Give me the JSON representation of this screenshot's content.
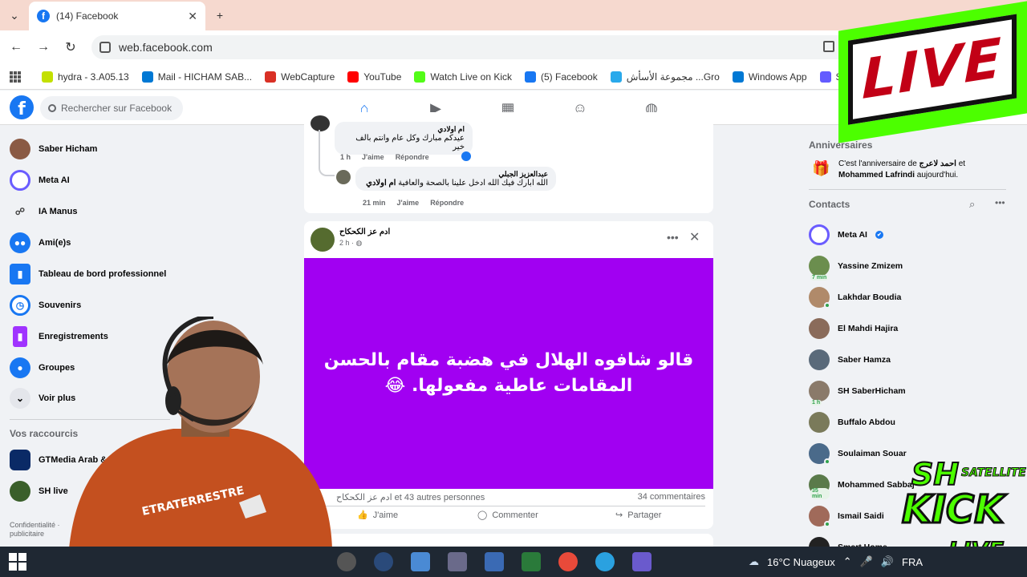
{
  "browser": {
    "tab_title": "(14) Facebook",
    "url": "web.facebook.com",
    "bookmarks": [
      {
        "label": "hydra - 3.A05.13",
        "color": "#c3e000"
      },
      {
        "label": "Mail - HICHAM SAB...",
        "color": "#0078d4"
      },
      {
        "label": "WebCapture",
        "color": "#d93025"
      },
      {
        "label": "YouTube",
        "color": "#ff0000"
      },
      {
        "label": "Watch Live on Kick",
        "color": "#53fc18"
      },
      {
        "label": "(5) Facebook",
        "color": "#1877f2"
      },
      {
        "label": "مجموعة الأسأش ...Gro",
        "color": "#29a9eb"
      },
      {
        "label": "Windows App",
        "color": "#0078d4"
      },
      {
        "label": "Stripe Express",
        "color": "#635bff"
      }
    ]
  },
  "facebook": {
    "search_placeholder": "Rechercher sur Facebook",
    "left_nav": [
      {
        "label": "Saber Hicham",
        "icon": "user-avatar",
        "color": "#8a5a44"
      },
      {
        "label": "Meta AI",
        "icon": "meta-ai-icon",
        "color": "#6a5cff"
      },
      {
        "label": "IA Manus",
        "icon": "manus-icon",
        "color": "#444444"
      },
      {
        "label": "Ami(e)s",
        "icon": "friends-icon",
        "color": "#1877f2"
      },
      {
        "label": "Tableau de bord professionnel",
        "icon": "dashboard-icon",
        "color": "#1877f2"
      },
      {
        "label": "Souvenirs",
        "icon": "memories-icon",
        "color": "#1877f2"
      },
      {
        "label": "Enregistrements",
        "icon": "saved-icon",
        "color": "#a033ff"
      },
      {
        "label": "Groupes",
        "icon": "groups-icon",
        "color": "#1877f2"
      },
      {
        "label": "Voir plus",
        "icon": "chevron-down-icon",
        "color": "#e4e6eb"
      }
    ],
    "shortcuts_title": "Vos raccourcis",
    "shortcuts": [
      {
        "label": "GTMedia Arab & Eu...",
        "color": "#0a2a66"
      },
      {
        "label": "SH live",
        "color": "#3a5f2a"
      }
    ],
    "privacy_text": "Confidentialité · publicitaire"
  },
  "feed": {
    "comment1": {
      "author": "ام اولادي",
      "text": "عيدكم مبارك وكل عام وانتم بالف خير",
      "time": "1 h",
      "like": "J'aime",
      "reply": "Répondre"
    },
    "comment2": {
      "author": "عبدالعزيز الجبلي",
      "mention": "ام اولادي",
      "text": "الله ابارك فيك الله ادخل علينا بالصحة والعافية",
      "time": "21 min",
      "like": "J'aime",
      "reply": "Répondre"
    },
    "post": {
      "author": "ادم عز الكحكاح",
      "time": "2 h",
      "line1": "قالو شافوه الهلال في هضبة مقام بالحسن",
      "line2": "المقامات عاطية مفعولها. 😂",
      "reactions": "ادم عز الكحكاح et 43 autres personnes",
      "comments": "34 commentaires",
      "like": "J'aime",
      "comment": "Commenter",
      "share": "Partager"
    }
  },
  "right_column": {
    "birthdays_title": "Anniversaires",
    "birthday_prefix": "C'est l'anniversaire de ",
    "birthday_name1": "احمد لاعرج",
    "birthday_and": " et ",
    "birthday_name2": "Mohammed Lafrindi",
    "birthday_suffix": " aujourd'hui.",
    "contacts_title": "Contacts",
    "contacts": [
      {
        "name": "Meta AI",
        "color": "#6a5cff",
        "online": false,
        "ago": ""
      },
      {
        "name": "Yassine Zmizem",
        "color": "#6b8e4e",
        "online": false,
        "ago": "7 min"
      },
      {
        "name": "Lakhdar Boudia",
        "color": "#b08a6a",
        "online": true,
        "ago": ""
      },
      {
        "name": "El Mahdi Hajira",
        "color": "#8a6b5a",
        "online": false,
        "ago": ""
      },
      {
        "name": "Saber Hamza",
        "color": "#5a6a7a",
        "online": false,
        "ago": ""
      },
      {
        "name": "SH SaberHicham",
        "color": "#8a7a6a",
        "online": false,
        "ago": "1 h"
      },
      {
        "name": "Buffalo Abdou",
        "color": "#7a7a5a",
        "online": false,
        "ago": ""
      },
      {
        "name": "Soulaiman Souar",
        "color": "#4a6a8a",
        "online": true,
        "ago": ""
      },
      {
        "name": "Mohammed Sabbaj",
        "color": "#5a7a4a",
        "online": false,
        "ago": "35 min"
      },
      {
        "name": "Ismail Saidi",
        "color": "#a06a5a",
        "online": true,
        "ago": ""
      },
      {
        "name": "Smart Home",
        "color": "#222222",
        "online": false,
        "ago": ""
      }
    ]
  },
  "overlays": {
    "live_badge": "LIVE",
    "kick_sh": "SH",
    "kick_satellite": "SATELLITE",
    "kick_word": "KICK",
    "kick_live": "LIVE",
    "shirt_text": "ETRATERRESTRE"
  },
  "taskbar": {
    "weather": "16°C  Nuageux",
    "language": "FRA"
  }
}
